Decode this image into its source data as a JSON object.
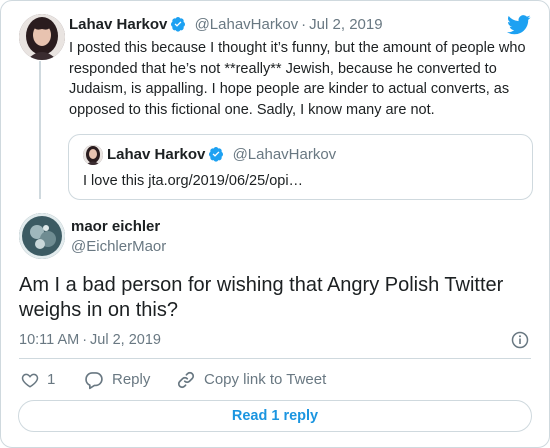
{
  "parent": {
    "author_name": "Lahav Harkov",
    "author_handle": "@LahavHarkov",
    "date": "Jul 2, 2019",
    "text": "I posted this because I thought it’s funny, but the amount of people who responded that he’s not **really** Jewish, because he converted to Judaism, is appalling. I hope people are kinder to actual converts, as opposed to this fictional one. Sadly, I know many are not.",
    "quote": {
      "author_name": "Lahav Harkov",
      "author_handle": "@LahavHarkov",
      "text": "I love this jta.org/2019/06/25/opi…"
    }
  },
  "tweet": {
    "author_name": "maor eichler",
    "author_handle": "@EichlerMaor",
    "text": "Am I a bad person for wishing that Angry Polish Twitter weighs in on this?",
    "time": "10:11 AM",
    "date": "Jul 2, 2019",
    "like_count": "1",
    "reply_label": "Reply",
    "copy_link_label": "Copy link to Tweet",
    "read_replies_label": "Read 1 reply"
  },
  "colors": {
    "brand_blue": "#1da1f2",
    "link_blue": "#1b95e0",
    "text": "#1c2022",
    "secondary": "#697882",
    "border": "#cfd9de"
  },
  "icons": [
    "verified-badge-icon",
    "twitter-bird-icon",
    "info-icon",
    "heart-icon",
    "reply-icon",
    "link-icon"
  ]
}
